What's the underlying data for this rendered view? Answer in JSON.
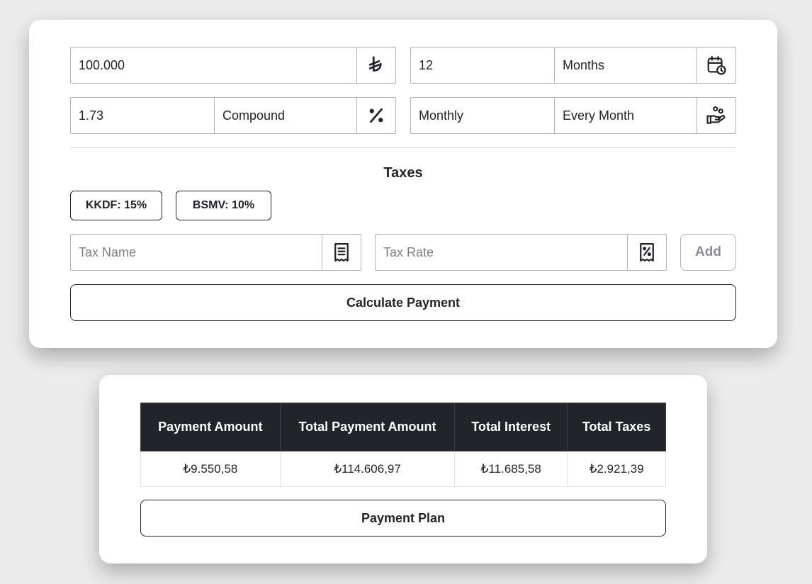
{
  "loan_form": {
    "amount": {
      "value": "100.000",
      "icon": "lira-icon"
    },
    "term": {
      "value": "12",
      "unit": "Months",
      "icon": "calendar-clock-icon"
    },
    "rate": {
      "value": "1.73",
      "type": "Compound",
      "icon": "percent-icon"
    },
    "frequency": {
      "period": "Monthly",
      "schedule": "Every Month",
      "icon": "hand-coins-icon"
    }
  },
  "taxes": {
    "title": "Taxes",
    "chips": [
      {
        "label": "KKDF: 15%"
      },
      {
        "label": "BSMV: 10%"
      }
    ],
    "name_placeholder": "Tax Name",
    "rate_placeholder": "Tax Rate",
    "add_label": "Add"
  },
  "calculate_label": "Calculate Payment",
  "results": {
    "headers": [
      "Payment Amount",
      "Total Payment Amount",
      "Total Interest",
      "Total Taxes"
    ],
    "values": [
      "₺9.550,58",
      "₺114.606,97",
      "₺11.685,58",
      "₺2.921,39"
    ]
  },
  "payment_plan_label": "Payment Plan",
  "colors": {
    "background": "#ececec",
    "header_dark": "#212529",
    "border": "#adb5bd"
  }
}
